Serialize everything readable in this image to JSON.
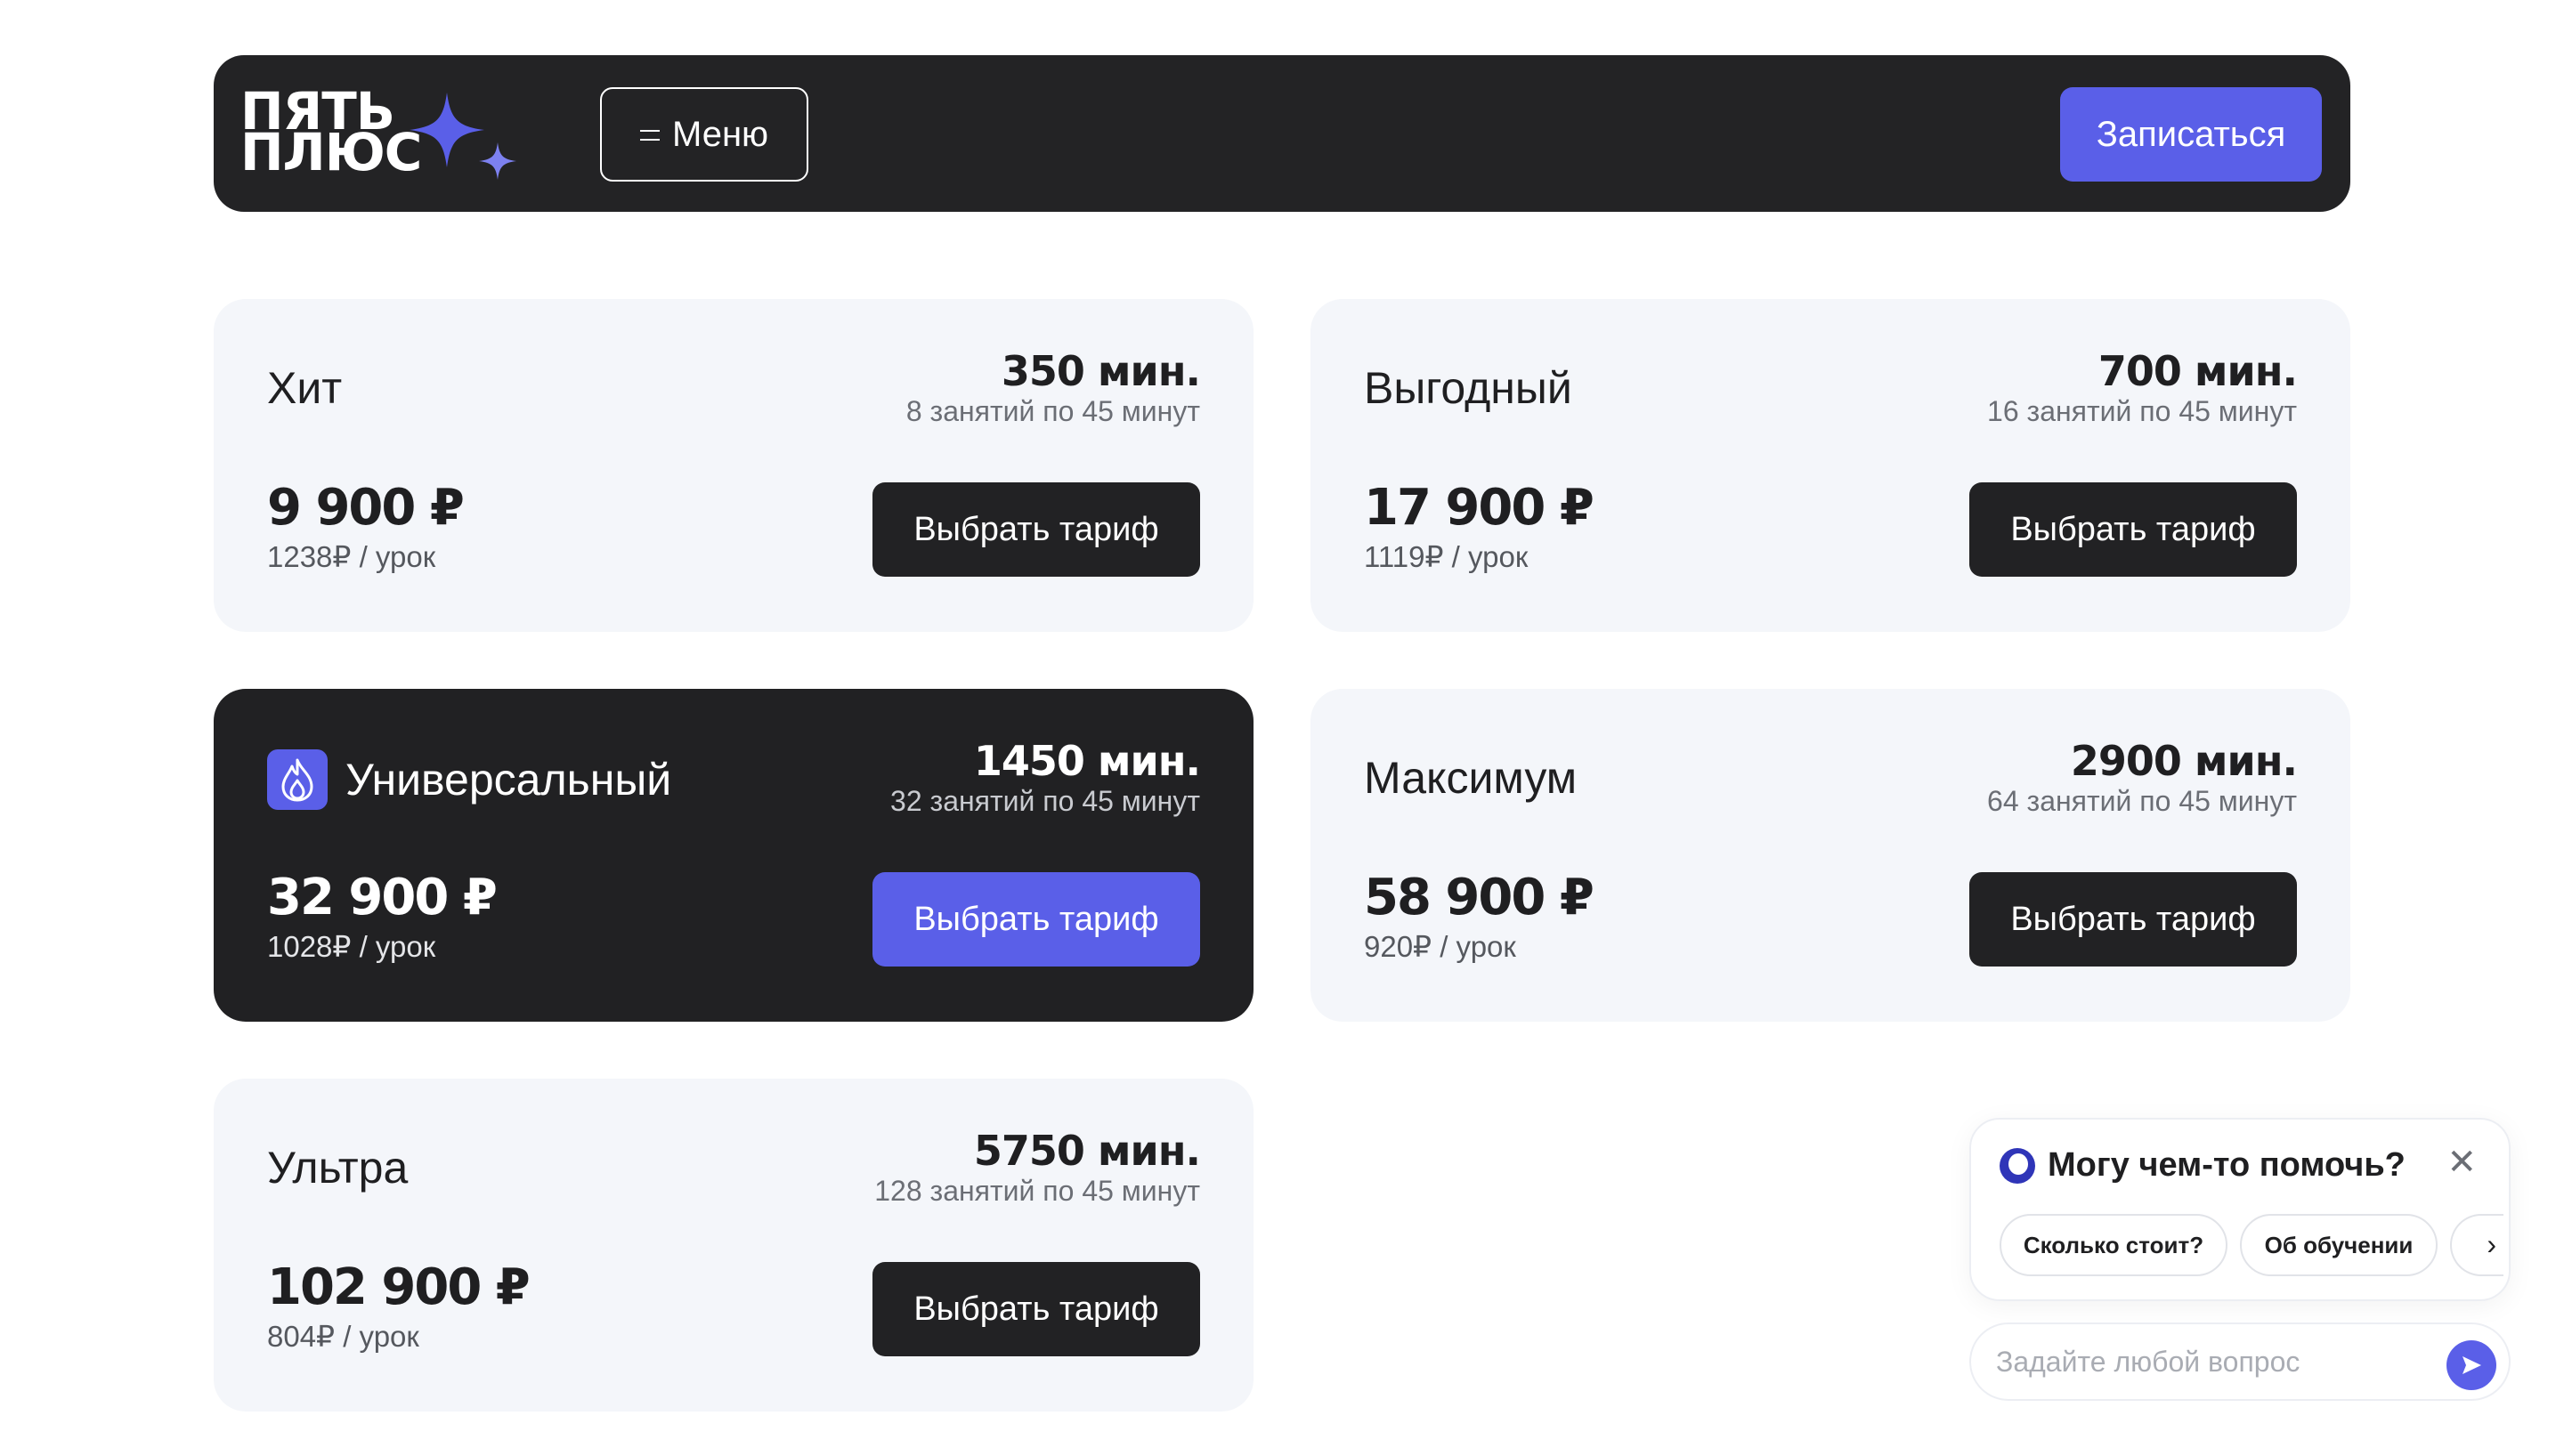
{
  "header": {
    "logo_line1": "ПЯТЬ",
    "logo_line2": "ПЛЮС",
    "menu_label": "Меню",
    "signup_label": "Записаться"
  },
  "colors": {
    "accent": "#5a5fe8",
    "dark": "#232325",
    "card_bg": "#f4f6fa"
  },
  "plans": [
    {
      "name": "Хит",
      "minutes": "350 мин.",
      "lessons": "8 занятий по 45 минут",
      "price": "9 900 ₽",
      "per_lesson": "1238₽ / урок",
      "button": "Выбрать тариф"
    },
    {
      "name": "Выгодный",
      "minutes": "700 мин.",
      "lessons": "16 занятий по 45 минут",
      "price": "17 900 ₽",
      "per_lesson": "1119₽ / урок",
      "button": "Выбрать тариф"
    },
    {
      "name": "Универсальный",
      "minutes": "1450 мин.",
      "lessons": "32 занятий по 45 минут",
      "price": "32 900 ₽",
      "per_lesson": "1028₽ / урок",
      "button": "Выбрать тариф",
      "highlighted": true,
      "icon": "flame-icon"
    },
    {
      "name": "Максимум",
      "minutes": "2900 мин.",
      "lessons": "64 занятий по 45 минут",
      "price": "58 900 ₽",
      "per_lesson": "920₽ / урок",
      "button": "Выбрать тариф"
    },
    {
      "name": "Ультра",
      "minutes": "5750 мин.",
      "lessons": "128 занятий по 45 минут",
      "price": "102 900 ₽",
      "per_lesson": "804₽ / урок",
      "button": "Выбрать тариф"
    }
  ],
  "chat": {
    "title": "Могу чем-то помочь?",
    "chips": [
      "Сколько стоит?",
      "Об обучении"
    ],
    "input_placeholder": "Задайте любой вопрос"
  }
}
